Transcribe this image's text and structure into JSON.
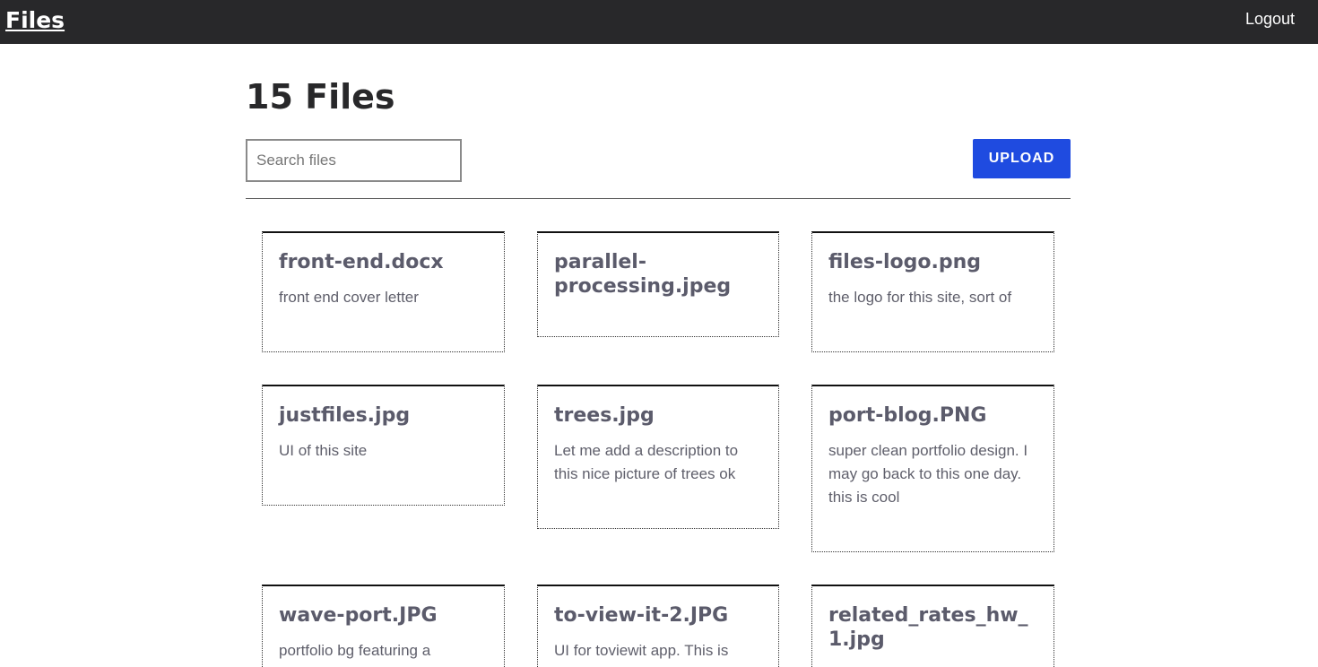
{
  "header": {
    "brand": "Files",
    "logout_label": "Logout"
  },
  "main": {
    "title": "15 Files",
    "search_placeholder": "Search files",
    "search_value": "",
    "upload_label": "UPLOAD"
  },
  "files": [
    {
      "name": "front-end.docx",
      "description": "front end cover letter"
    },
    {
      "name": "parallel-processing.jpeg",
      "description": ""
    },
    {
      "name": "files-logo.png",
      "description": "the logo for this site, sort of"
    },
    {
      "name": "justfiles.jpg",
      "description": "UI of this site"
    },
    {
      "name": "trees.jpg",
      "description": "Let me add a description to this nice picture of trees ok"
    },
    {
      "name": "port-blog.PNG",
      "description": "super clean portfolio design. I may go back to this one day. this is cool"
    },
    {
      "name": "wave-port.JPG",
      "description": "portfolio bg featuring a"
    },
    {
      "name": "to-view-it-2.JPG",
      "description": "UI for toviewit app. This is"
    },
    {
      "name": "related_rates_hw_1.jpg",
      "description": ""
    }
  ]
}
